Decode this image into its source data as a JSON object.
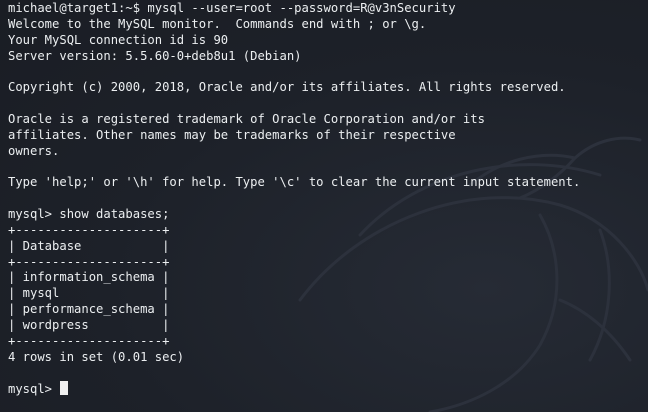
{
  "terminal": {
    "lines": [
      "michael@target1:~$ mysql --user=root --password=R@v3nSecurity",
      "Welcome to the MySQL monitor.  Commands end with ; or \\g.",
      "Your MySQL connection id is 90",
      "Server version: 5.5.60-0+deb8u1 (Debian)",
      "",
      "Copyright (c) 2000, 2018, Oracle and/or its affiliates. All rights reserved.",
      "",
      "Oracle is a registered trademark of Oracle Corporation and/or its",
      "affiliates. Other names may be trademarks of their respective",
      "owners.",
      "",
      "Type 'help;' or '\\h' for help. Type '\\c' to clear the current input statement.",
      "",
      "mysql> show databases;",
      "+--------------------+",
      "| Database           |",
      "+--------------------+",
      "| information_schema |",
      "| mysql              |",
      "| performance_schema |",
      "| wordpress          |",
      "+--------------------+",
      "4 rows in set (0.01 sec)",
      "",
      "mysql> "
    ],
    "colors": {
      "background": "#1e222b",
      "text": "#eceff1",
      "cursor": "#f0f0f0",
      "watermark": "#2c313c"
    },
    "watermark_icon": "kali-dragon-icon"
  }
}
